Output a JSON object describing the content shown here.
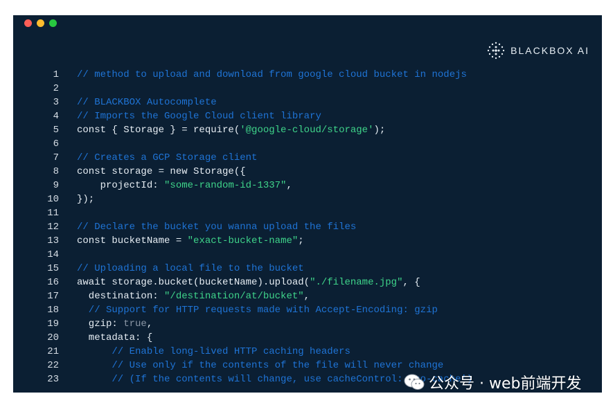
{
  "window": {
    "controls": [
      {
        "name": "close",
        "color": "#ff5f57"
      },
      {
        "name": "minimize",
        "color": "#febc2e"
      },
      {
        "name": "maximize",
        "color": "#28c840"
      }
    ]
  },
  "brand": {
    "name": "BLACKBOX AI",
    "icon": "blackbox-dots-icon"
  },
  "colors": {
    "background": "#0b1f33",
    "comment": "#1f74d6",
    "string": "#3fd48a",
    "keyword_default": "#e6edf3",
    "boolean": "#8b97a6"
  },
  "code": {
    "lines": [
      {
        "n": "1",
        "tokens": [
          {
            "t": "// method to upload and download from google cloud bucket in nodejs",
            "k": "comment"
          }
        ]
      },
      {
        "n": "2",
        "tokens": []
      },
      {
        "n": "3",
        "tokens": [
          {
            "t": "// BLACKBOX Autocomplete",
            "k": "comment"
          }
        ]
      },
      {
        "n": "4",
        "tokens": [
          {
            "t": "// Imports the Google Cloud client library",
            "k": "comment"
          }
        ]
      },
      {
        "n": "5",
        "tokens": [
          {
            "t": "const { Storage } = require(",
            "k": "plain"
          },
          {
            "t": "'@google-cloud/storage'",
            "k": "str"
          },
          {
            "t": ");",
            "k": "plain"
          }
        ]
      },
      {
        "n": "6",
        "tokens": []
      },
      {
        "n": "7",
        "tokens": [
          {
            "t": "// Creates a GCP Storage client",
            "k": "comment"
          }
        ]
      },
      {
        "n": "8",
        "tokens": [
          {
            "t": "const storage = new Storage({",
            "k": "plain"
          }
        ]
      },
      {
        "n": "9",
        "tokens": [
          {
            "t": "    projectId: ",
            "k": "plain"
          },
          {
            "t": "\"some-random-id-1337\"",
            "k": "str"
          },
          {
            "t": ",",
            "k": "plain"
          }
        ]
      },
      {
        "n": "10",
        "tokens": [
          {
            "t": "});",
            "k": "plain"
          }
        ]
      },
      {
        "n": "11",
        "tokens": []
      },
      {
        "n": "12",
        "tokens": [
          {
            "t": "// Declare the bucket you wanna upload the files",
            "k": "comment"
          }
        ]
      },
      {
        "n": "13",
        "tokens": [
          {
            "t": "const bucketName = ",
            "k": "plain"
          },
          {
            "t": "\"exact-bucket-name\"",
            "k": "str"
          },
          {
            "t": ";",
            "k": "plain"
          }
        ]
      },
      {
        "n": "14",
        "tokens": []
      },
      {
        "n": "15",
        "tokens": [
          {
            "t": "// Uploading a local file to the bucket",
            "k": "comment"
          }
        ]
      },
      {
        "n": "16",
        "tokens": [
          {
            "t": "await storage.bucket(bucketName).upload(",
            "k": "plain"
          },
          {
            "t": "\"./filename.jpg\"",
            "k": "str"
          },
          {
            "t": ", {",
            "k": "plain"
          }
        ]
      },
      {
        "n": "17",
        "tokens": [
          {
            "t": "  destination: ",
            "k": "plain"
          },
          {
            "t": "\"/destination/at/bucket\"",
            "k": "str"
          },
          {
            "t": ",",
            "k": "plain"
          }
        ]
      },
      {
        "n": "18",
        "tokens": [
          {
            "t": "  // Support for HTTP requests made with Accept-Encoding: gzip",
            "k": "comment"
          }
        ]
      },
      {
        "n": "19",
        "tokens": [
          {
            "t": "  gzip: ",
            "k": "plain"
          },
          {
            "t": "true",
            "k": "bool"
          },
          {
            "t": ",",
            "k": "plain"
          }
        ]
      },
      {
        "n": "20",
        "tokens": [
          {
            "t": "  metadata: {",
            "k": "plain"
          }
        ]
      },
      {
        "n": "21",
        "tokens": [
          {
            "t": "      // Enable long-lived HTTP caching headers",
            "k": "comment"
          }
        ]
      },
      {
        "n": "22",
        "tokens": [
          {
            "t": "      // Use only if the contents of the file will never change",
            "k": "comment"
          }
        ]
      },
      {
        "n": "23",
        "tokens": [
          {
            "t": "      // (If the contents will change, use cacheControl: 'no-cache')",
            "k": "comment"
          }
        ]
      }
    ]
  },
  "watermark": {
    "text": "公众号 · web前端开发",
    "icon": "wechat-icon"
  }
}
